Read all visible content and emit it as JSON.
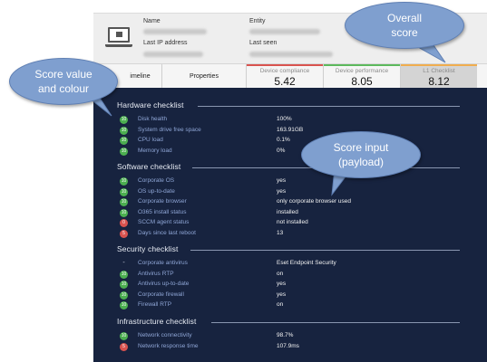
{
  "header": {
    "name_label": "Name",
    "entity_label": "Entity",
    "last_ip_label": "Last IP address",
    "last_seen_label": "Last seen",
    "device_icon": "laptop-icon"
  },
  "tabs": {
    "timeline": "imeline",
    "properties": "Properties",
    "scores": [
      {
        "label": "Device compliance",
        "value": "5.42"
      },
      {
        "label": "Device performance",
        "value": "8.05"
      },
      {
        "label": "L1 Checklist",
        "value": "8.12"
      }
    ]
  },
  "colors": {
    "panel_bg": "#17233f",
    "good": "#4caf50",
    "bad": "#d9534f",
    "callout": "#7f9fcf",
    "row_label": "#8fa6d6"
  },
  "sections": [
    {
      "title": "Hardware checklist",
      "rows": [
        {
          "score": "10",
          "status": "good",
          "label": "Disk health",
          "value": "100%"
        },
        {
          "score": "10",
          "status": "good",
          "label": "System drive free space",
          "value": "163.91GB"
        },
        {
          "score": "10",
          "status": "good",
          "label": "CPU load",
          "value": "0.1%"
        },
        {
          "score": "10",
          "status": "good",
          "label": "Memory load",
          "value": "0%"
        }
      ]
    },
    {
      "title": "Software checklist",
      "rows": [
        {
          "score": "10",
          "status": "good",
          "label": "Corporate OS",
          "value": "yes"
        },
        {
          "score": "10",
          "status": "good",
          "label": "OS up-to-date",
          "value": "yes"
        },
        {
          "score": "10",
          "status": "good",
          "label": "Corporate browser",
          "value": "only corporate browser used"
        },
        {
          "score": "10",
          "status": "good",
          "label": "O365 install status",
          "value": "installed"
        },
        {
          "score": "0",
          "status": "bad",
          "label": "SCCM agent status",
          "value": "not installed"
        },
        {
          "score": "5",
          "status": "bad",
          "label": "Days since last reboot",
          "value": "13"
        }
      ]
    },
    {
      "title": "Security checklist",
      "rows": [
        {
          "score": "-",
          "status": "none",
          "label": "Corporate antivirus",
          "value": "Eset Endpoint Security"
        },
        {
          "score": "10",
          "status": "good",
          "label": "Antivirus RTP",
          "value": "on"
        },
        {
          "score": "10",
          "status": "good",
          "label": "Antivirus up-to-date",
          "value": "yes"
        },
        {
          "score": "10",
          "status": "good",
          "label": "Corporate firewall",
          "value": "yes"
        },
        {
          "score": "10",
          "status": "good",
          "label": "Firewall RTP",
          "value": "on"
        }
      ]
    },
    {
      "title": "Infrastructure checklist",
      "rows": [
        {
          "score": "10",
          "status": "good",
          "label": "Network connectivity",
          "value": "98.7%"
        },
        {
          "score": "5",
          "status": "bad",
          "label": "Network response time",
          "value": "107.9ms"
        }
      ]
    }
  ],
  "callouts": {
    "overall": {
      "line1": "Overall",
      "line2": "score"
    },
    "score_value": {
      "line1": "Score value",
      "line2": "and colour"
    },
    "score_input": {
      "line1": "Score input",
      "line2": "(payload)"
    }
  }
}
